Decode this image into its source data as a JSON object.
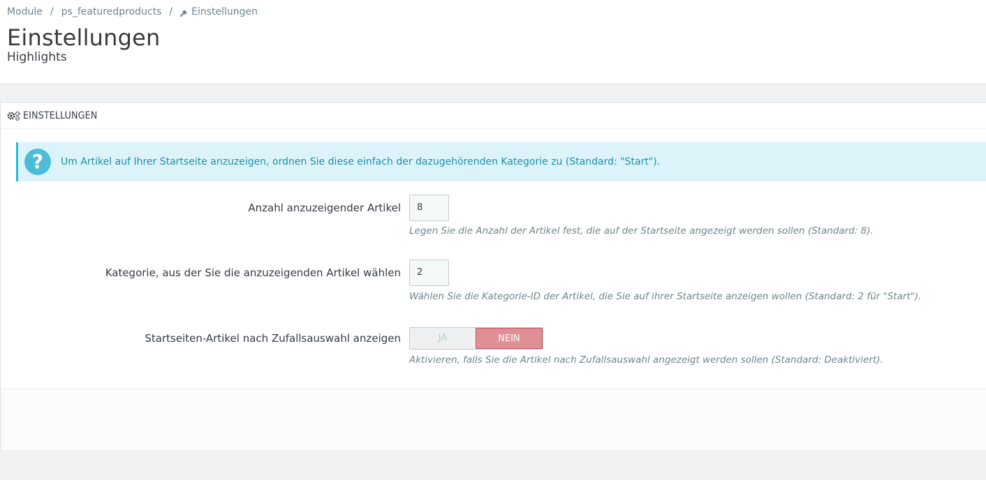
{
  "breadcrumb": {
    "items": [
      "Module",
      "ps_featuredproducts",
      "Einstellungen"
    ],
    "separator": "/"
  },
  "header": {
    "title": "Einstellungen",
    "subtitle": "Highlights"
  },
  "panel": {
    "heading": "EINSTELLUNGEN",
    "heading_icon": "cogs-icon",
    "alert": {
      "icon": "question-icon",
      "icon_glyph": "?",
      "text": "Um Artikel auf Ihrer Startseite anzuzeigen, ordnen Sie diese einfach der dazugehörenden Kategorie zu (Standard: \"Start\")."
    },
    "fields": [
      {
        "label": "Anzahl anzuzeigender Artikel",
        "value": "8",
        "help": "Legen Sie die Anzahl der Artikel fest, die auf der Startseite angezeigt werden sollen (Standard: 8)."
      },
      {
        "label": "Kategorie, aus der Sie die anzuzeigenden Artikel wählen",
        "value": "2",
        "help": "Wählen Sie die Kategorie-ID der Artikel, die Sie auf ihrer Startseite anzeigen wollen (Standard: 2 für \"Start\")."
      },
      {
        "label": "Startseiten-Artikel nach Zufallsauswahl anzeigen",
        "yes_label": "JA",
        "no_label": "NEIN",
        "selected": "NEIN",
        "help": "Aktivieren, falls Sie die Artikel nach Zufallsauswahl angezeigt werden sollen (Standard: Deaktiviert)."
      }
    ]
  },
  "colors": {
    "background": "#eff1f2",
    "alert_bg": "#dcf4f9",
    "alert_text": "#1f8fa5",
    "switch_no_bg": "#e08f95",
    "help_text": "#6c868e"
  }
}
